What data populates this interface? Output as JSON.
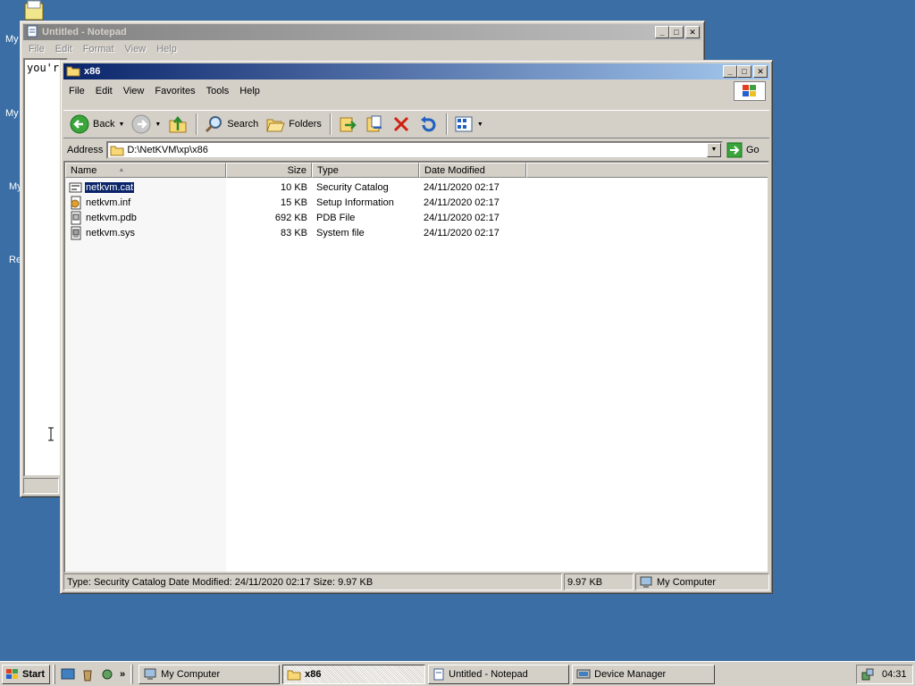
{
  "desktop": {
    "labels": [
      "My",
      "My",
      "My",
      "Re"
    ]
  },
  "notepad": {
    "title": "Untitled - Notepad",
    "menu": [
      "File",
      "Edit",
      "Format",
      "View",
      "Help"
    ],
    "text": "you'r"
  },
  "explorer": {
    "title": "x86",
    "menu": [
      "File",
      "Edit",
      "View",
      "Favorites",
      "Tools",
      "Help"
    ],
    "toolbar": {
      "back": "Back",
      "search": "Search",
      "folders": "Folders"
    },
    "address": {
      "label": "Address",
      "value": "D:\\NetKVM\\xp\\x86",
      "go": "Go"
    },
    "columns": [
      "Name",
      "Size",
      "Type",
      "Date Modified"
    ],
    "files": [
      {
        "name": "netkvm.cat",
        "size": "10 KB",
        "type": "Security Catalog",
        "date": "24/11/2020 02:17",
        "icon": "catalog-icon"
      },
      {
        "name": "netkvm.inf",
        "size": "15 KB",
        "type": "Setup Information",
        "date": "24/11/2020 02:17",
        "icon": "setup-info-icon"
      },
      {
        "name": "netkvm.pdb",
        "size": "692 KB",
        "type": "PDB File",
        "date": "24/11/2020 02:17",
        "icon": "file-icon"
      },
      {
        "name": "netkvm.sys",
        "size": "83 KB",
        "type": "System file",
        "date": "24/11/2020 02:17",
        "icon": "system-file-icon"
      }
    ],
    "selected_index": 0,
    "status": {
      "info": "Type: Security Catalog Date Modified: 24/11/2020 02:17 Size: 9.97 KB",
      "size": "9.97 KB",
      "zone": "My Computer"
    }
  },
  "taskbar": {
    "start": "Start",
    "overflow": "»",
    "tasks": [
      {
        "label": "My Computer",
        "active": false
      },
      {
        "label": "x86",
        "active": true
      },
      {
        "label": "Untitled - Notepad",
        "active": false
      },
      {
        "label": "Device Manager",
        "active": false
      }
    ],
    "clock": "04:31"
  }
}
